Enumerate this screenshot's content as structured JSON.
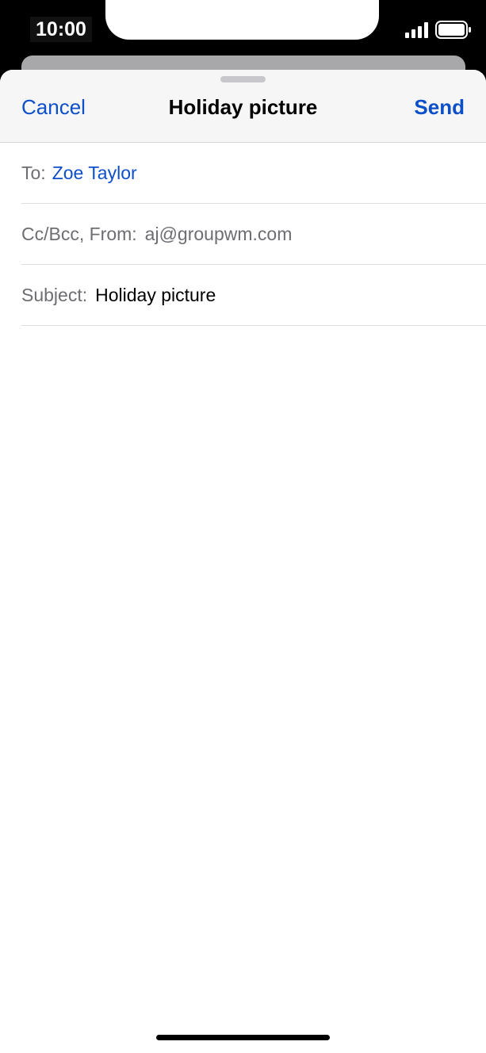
{
  "status_bar": {
    "time": "10:00",
    "icons": [
      "cellular-signal-icon",
      "battery-icon"
    ]
  },
  "compose": {
    "cancel_label": "Cancel",
    "title": "Holiday picture",
    "send_label": "Send",
    "to_label": "To:",
    "to_value": "Zoe Taylor",
    "cc_from_label": "Cc/Bcc, From:",
    "from_value": "aj@groupwm.com",
    "subject_label": "Subject:",
    "subject_value": "Holiday picture",
    "body": ""
  },
  "colors": {
    "accent": "#0d4fc9",
    "label_gray": "#6d6d72",
    "nav_background": "#f6f6f6"
  }
}
